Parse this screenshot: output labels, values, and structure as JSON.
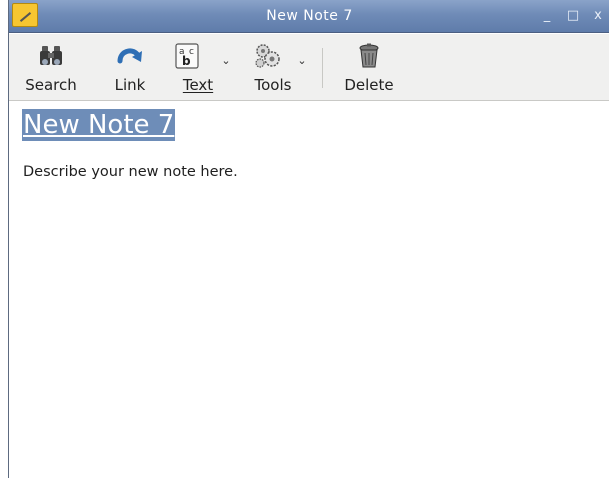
{
  "window": {
    "title": "New Note 7",
    "minimize_glyph": "_",
    "maximize_glyph": "□",
    "close_glyph": "x"
  },
  "toolbar": {
    "search_label": "Search",
    "link_label": "Link",
    "text_label": "Text",
    "tools_label": "Tools",
    "delete_label": "Delete",
    "text_caret": "⌄",
    "tools_caret": "⌄"
  },
  "icons": {
    "app": "note-pencil-icon",
    "search": "binoculars-icon",
    "link": "curved-arrow-icon",
    "text": "text-format-icon",
    "tools": "gears-icon",
    "delete": "trash-can-icon"
  },
  "note": {
    "title": "New Note 7",
    "body": "Describe your new note here."
  },
  "colors": {
    "titlebar": "#6f8bb7",
    "selection": "#6e8db8",
    "toolbar": "#f0f0ef",
    "app_icon": "#f7c631"
  }
}
